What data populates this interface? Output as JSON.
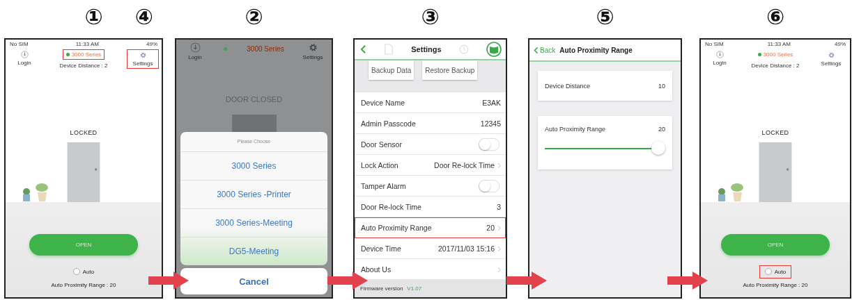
{
  "panels": [
    {
      "kind": "home",
      "steps": [
        "①",
        "④"
      ],
      "status_bar": {
        "carrier": "No SIM",
        "time": "11:33 AM",
        "battery": "49%"
      },
      "login": "Login",
      "device": {
        "name": "3000 Series",
        "connected": true,
        "highlighted": true
      },
      "distance": "Device Distance : 2",
      "settings": {
        "label": "Settings",
        "highlighted": true
      },
      "door_status": "LOCKED",
      "open_button": "OPEN",
      "auto": {
        "label": "Auto",
        "checked": false,
        "highlighted": false
      },
      "range": "Auto Proximity Range : 20"
    },
    {
      "kind": "picker",
      "steps": [
        "②"
      ],
      "login": "Login",
      "device": {
        "name": "3000 Series",
        "connected": true
      },
      "settings": "Settings",
      "door_status": "DOOR CLOSED",
      "sheet_title": "Please Choose",
      "options": [
        {
          "label": "3000 Series",
          "selected": false
        },
        {
          "label": "3000 Series -Printer",
          "selected": false
        },
        {
          "label": "3000 Series-Meeting",
          "selected": false
        },
        {
          "label": "DG5-Meeting",
          "selected": false
        }
      ],
      "cancel": "Cancel"
    },
    {
      "kind": "settings",
      "steps": [
        "③"
      ],
      "title": "Settings",
      "buttons": [
        "Backup Data",
        "Restore Backup"
      ],
      "rows": [
        {
          "kind": "value",
          "label": "Device Name",
          "value": "E3AK",
          "highlighted": false
        },
        {
          "kind": "value",
          "label": "Admin Passcode",
          "value": "12345",
          "highlighted": false
        },
        {
          "kind": "toggle",
          "label": "Door Sensor",
          "on": false,
          "highlighted": false
        },
        {
          "kind": "select",
          "label": "Lock Action",
          "value": "Door Re-lock Time",
          "highlighted": false
        },
        {
          "kind": "toggle",
          "label": "Tamper Alarm",
          "on": false,
          "highlighted": false
        },
        {
          "kind": "value",
          "label": "Door Re-lock Time",
          "value": "3",
          "highlighted": false
        },
        {
          "kind": "select",
          "label": "Auto Proximity Range",
          "value": "20",
          "highlighted": true
        },
        {
          "kind": "select",
          "label": "Device Time",
          "value": "2017/11/03 15:16",
          "highlighted": false
        },
        {
          "kind": "link",
          "label": "About Us",
          "highlighted": false
        }
      ],
      "firmware": {
        "label": "Firmware version",
        "version": "V1.07"
      }
    },
    {
      "kind": "range",
      "steps": [
        "⑤"
      ],
      "back": "Back",
      "title": "Auto Proximity Range",
      "distance": {
        "label": "Device Distance",
        "value": "10"
      },
      "slider": {
        "label": "Auto Proximity Range",
        "value": "20",
        "level": 0.95
      }
    },
    {
      "kind": "home",
      "steps": [
        "⑥"
      ],
      "status_bar": {
        "carrier": "No SIM",
        "time": "11:33 AM",
        "battery": "49%"
      },
      "login": "Login",
      "device": {
        "name": "3000 Series",
        "connected": true,
        "highlighted": false
      },
      "distance": "Device Distance : 2",
      "settings": {
        "label": "Settings",
        "highlighted": false
      },
      "door_status": "LOCKED",
      "open_button": "OPEN",
      "auto": {
        "label": "Auto",
        "checked": false,
        "highlighted": true
      },
      "range": "Auto Proximity Range : 20"
    }
  ]
}
